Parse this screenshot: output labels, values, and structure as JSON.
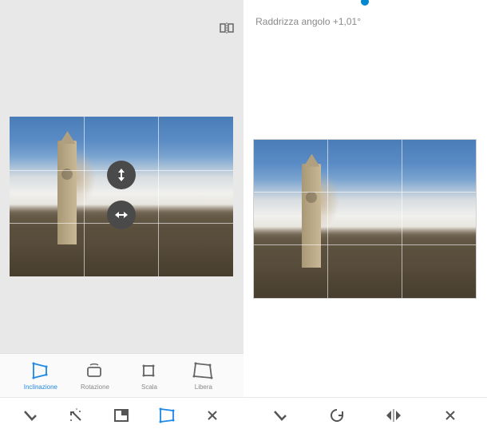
{
  "right_panel": {
    "status_text": "Raddrizza angolo +1,01°",
    "slider_value": 1.01
  },
  "sub_toolbar": {
    "items": [
      {
        "label": "Libera",
        "icon": "free-transform",
        "active": false
      },
      {
        "label": "Scala",
        "icon": "scale",
        "active": false
      },
      {
        "label": "Rotazione",
        "icon": "rotation",
        "active": false
      },
      {
        "label": "Inclinazione",
        "icon": "tilt",
        "active": true
      }
    ]
  },
  "bottom_bar_left": {
    "icons": [
      "cancel",
      "crop-or-skew",
      "aspect",
      "magic",
      "confirm"
    ]
  },
  "bottom_bar_right": {
    "icons": [
      "cancel",
      "mirror",
      "rotate-ccw",
      "confirm"
    ]
  },
  "handles": {
    "vertical": "vertical-drag",
    "horizontal": "horizontal-drag"
  }
}
